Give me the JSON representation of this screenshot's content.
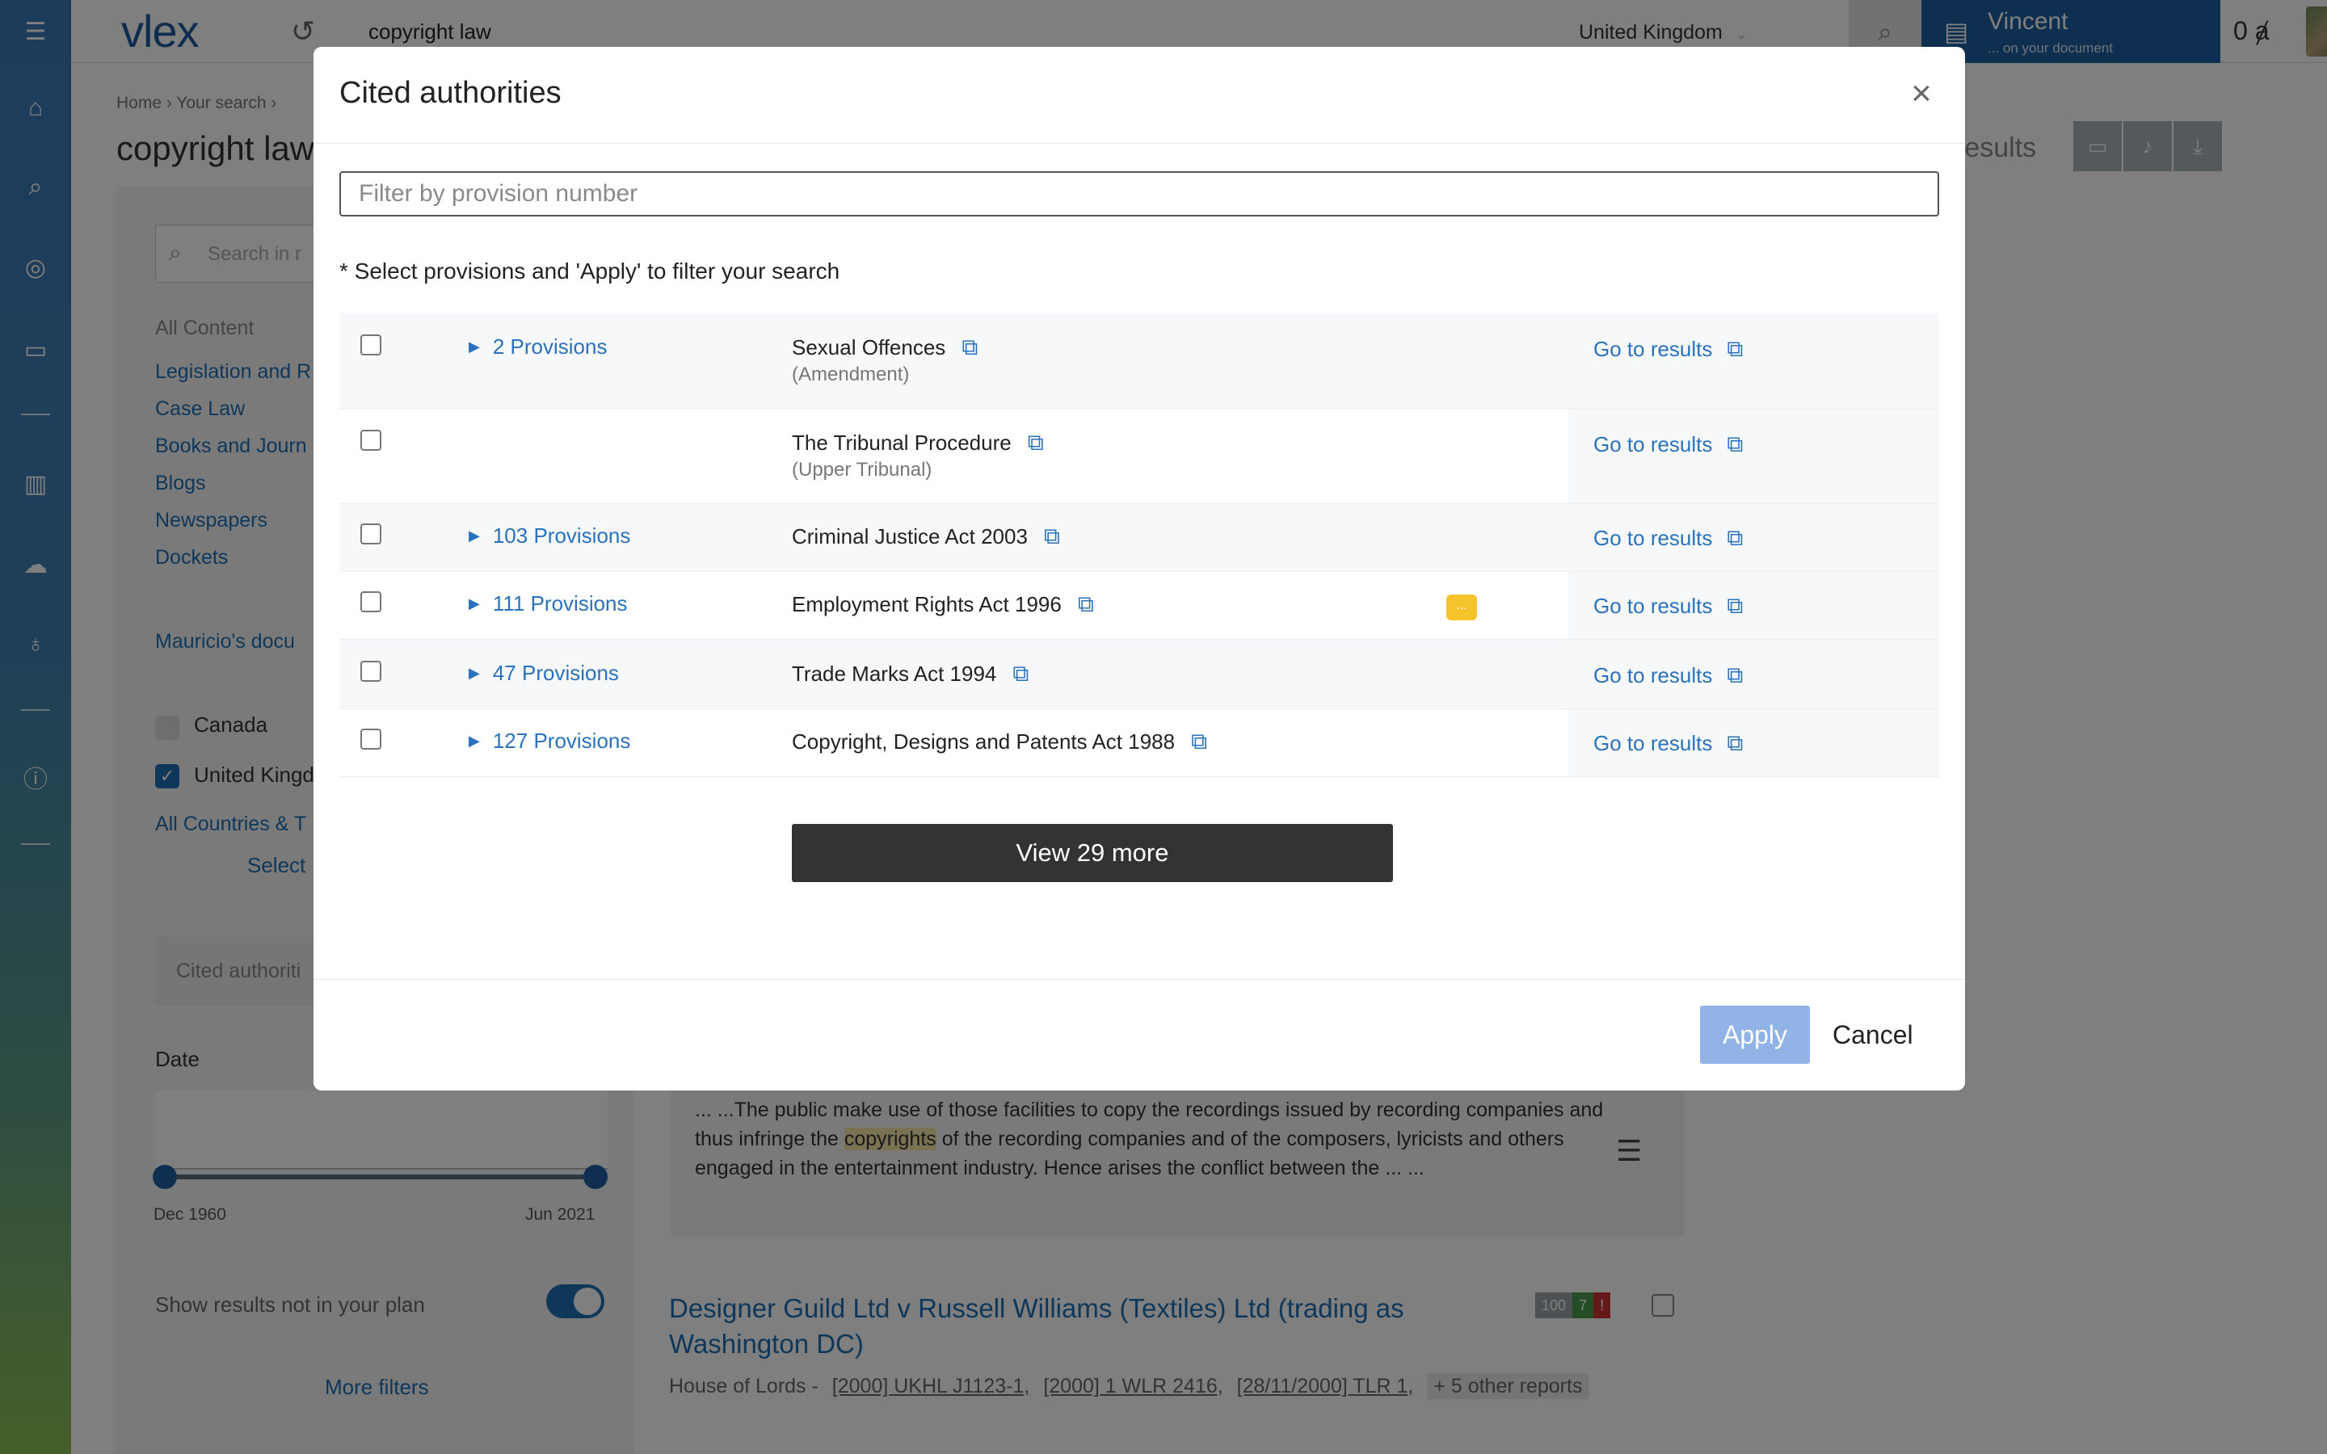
{
  "background": {
    "logo": "vlex",
    "search_query": "copyright law",
    "country": "United Kingdom",
    "user_name": "Vincent",
    "user_sub": "... on your document",
    "credits": "0 ⱥ",
    "breadcrumb": "Home › Your search ›",
    "page_title": "copyright law",
    "results_fragment": "results",
    "sidebar": {
      "search_placeholder": "Search in r",
      "heading_all_content": "All Content",
      "links": [
        "Legislation and R",
        "Case Law",
        "Books and Journ",
        "Blogs",
        "Newspapers",
        "Dockets"
      ],
      "user_docs": "Mauricio's docu",
      "countries": [
        "Canada",
        "United Kingd"
      ],
      "all_countries": "All Countries & T",
      "select": "Select",
      "cited_authorities": "Cited authoriti",
      "date_label": "Date",
      "date_min": "Dec 1960",
      "date_max": "Jun 2021",
      "show_results_label": "Show results not in your plan",
      "more_filters": "More filters"
    },
    "snippet": {
      "before": "... ...The public make use of those facilities to copy the recordings issued by recording companies and thus infringe the ",
      "highlight": "copyrights",
      "after": " of the recording companies and of the composers, lyricists and others engaged in the entertainment industry. Hence arises the conflict between the ... ..."
    },
    "result": {
      "title": "Designer Guild Ltd v Russell Williams (Textiles) Ltd (trading as Washington DC)",
      "court": "House of Lords -",
      "refs": [
        "[2000] UKHL J1123-1,",
        "[2000] 1 WLR 2416,",
        "[28/11/2000] TLR 1,"
      ],
      "other_reports": "+ 5 other reports",
      "badges": [
        "100",
        "7",
        "!"
      ]
    }
  },
  "modal": {
    "title": "Cited authorities",
    "close_symbol": "×",
    "filter_placeholder": "Filter by provision number",
    "instructions": "* Select provisions and 'Apply' to filter your search",
    "rows": [
      {
        "provisions": "2 Provisions",
        "name": "Sexual Offences",
        "sub": "(Amendment)",
        "goto": "Go to results"
      },
      {
        "provisions": "",
        "name": "The Tribunal Procedure",
        "sub": "(Upper Tribunal)",
        "goto": "Go to results"
      },
      {
        "provisions": "103 Provisions",
        "name": "Criminal Justice Act 2003",
        "sub": "",
        "goto": "Go to results"
      },
      {
        "provisions": "111 Provisions",
        "name": "Employment Rights Act 1996",
        "sub": "",
        "goto": "Go to results",
        "badge": "..."
      },
      {
        "provisions": "47 Provisions",
        "name": "Trade Marks Act 1994",
        "sub": "",
        "goto": "Go to results"
      },
      {
        "provisions": "127 Provisions",
        "name": "Copyright, Designs and Patents Act 1988",
        "sub": "",
        "goto": "Go to results"
      }
    ],
    "view_more": "View 29 more",
    "apply": "Apply",
    "cancel": "Cancel"
  },
  "icons": {
    "triangle": "▶",
    "external": "⧉"
  },
  "colors": {
    "link": "#2a72bd",
    "apply_button": "#92b3e6",
    "view_more_button": "#333333",
    "badge": "#f5c32c",
    "rail_top": "#3b78b8",
    "rail_bottom": "#8fbf52"
  }
}
